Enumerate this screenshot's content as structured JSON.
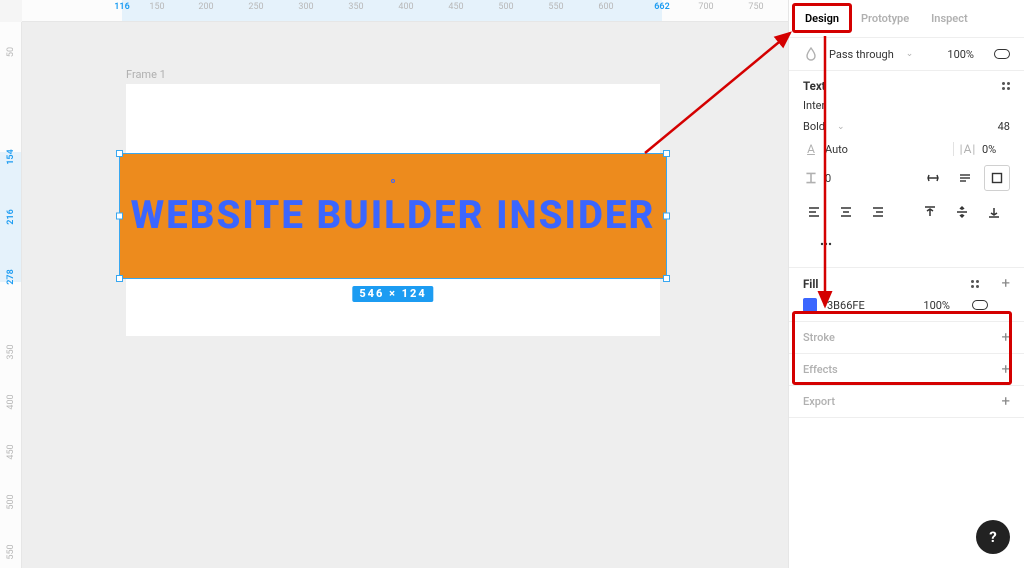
{
  "canvas": {
    "frame": {
      "label": "Frame 1"
    },
    "text_content": "WEBSITE BUILDER INSIDER",
    "selection_color_hex": "3B66FE",
    "selection_bg_hex": "ED8B1D",
    "dimensions_badge": "546 × 124"
  },
  "ruler": {
    "top_ticks": [
      "150",
      "200",
      "250",
      "300",
      "350",
      "400",
      "450",
      "500",
      "550",
      "600",
      "700",
      "750"
    ],
    "top_sel_start": "116",
    "top_sel_end": "662",
    "left_ticks": [
      "50",
      "350",
      "400",
      "450",
      "500",
      "550"
    ],
    "left_sel": [
      "154",
      "216",
      "278"
    ]
  },
  "panel": {
    "tabs": {
      "design": "Design",
      "prototype": "Prototype",
      "inspect": "Inspect"
    },
    "blend": {
      "mode": "Pass through",
      "opacity": "100%"
    },
    "text": {
      "title": "Text",
      "family": "Inter",
      "weight": "Bold",
      "size": "48",
      "line_height": "Auto",
      "letter_spacing": "0%",
      "paragraph_spacing": "0"
    },
    "fill": {
      "title": "Fill",
      "hex": "3B66FE",
      "opacity": "100%"
    },
    "stroke": {
      "title": "Stroke"
    },
    "effects": {
      "title": "Effects"
    },
    "export": {
      "title": "Export"
    }
  },
  "help_label": "?"
}
